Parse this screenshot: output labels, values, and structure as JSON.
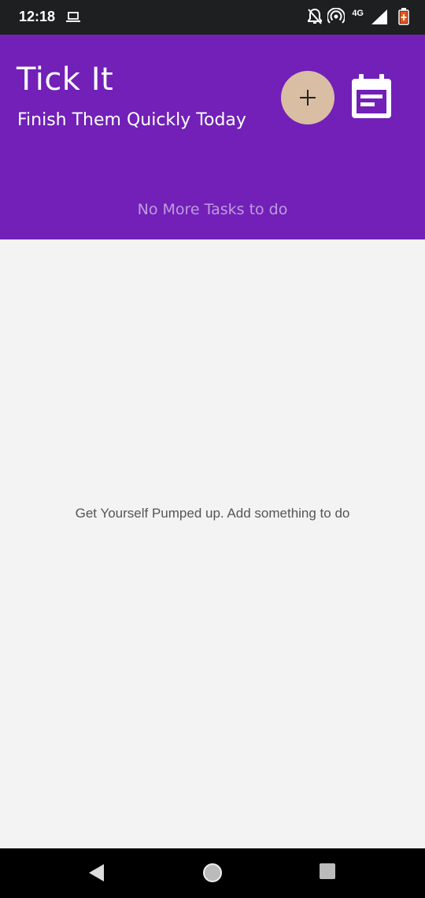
{
  "status_bar": {
    "time": "12:18",
    "icons": [
      "laptop-icon",
      "notifications-off-icon",
      "hotspot-icon",
      "network-4g-icon",
      "signal-icon",
      "battery-icon"
    ],
    "network_label": "4G",
    "battery_color": "#e8541c"
  },
  "header": {
    "title": "Tick It",
    "subtitle": "Finish Them Quickly Today",
    "empty_tasks": "No More Tasks to do",
    "background": "#7220b8",
    "add_button_color": "#d9bea3",
    "add_icon": "plus-icon",
    "calendar_icon": "calendar-icon"
  },
  "main": {
    "empty_message": "Get Yourself Pumped up. Add something to do"
  },
  "nav_bar": {
    "buttons": [
      "back-icon",
      "home-icon",
      "recents-icon"
    ]
  }
}
